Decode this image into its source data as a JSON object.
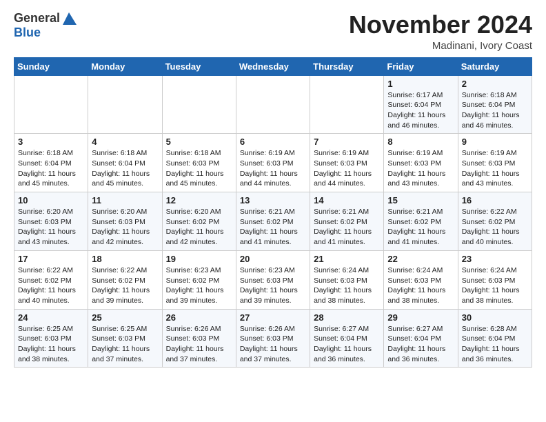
{
  "header": {
    "logo_general": "General",
    "logo_blue": "Blue",
    "month_title": "November 2024",
    "location": "Madinani, Ivory Coast"
  },
  "calendar": {
    "days_of_week": [
      "Sunday",
      "Monday",
      "Tuesday",
      "Wednesday",
      "Thursday",
      "Friday",
      "Saturday"
    ],
    "weeks": [
      [
        {
          "day": "",
          "info": ""
        },
        {
          "day": "",
          "info": ""
        },
        {
          "day": "",
          "info": ""
        },
        {
          "day": "",
          "info": ""
        },
        {
          "day": "",
          "info": ""
        },
        {
          "day": "1",
          "info": "Sunrise: 6:17 AM\nSunset: 6:04 PM\nDaylight: 11 hours and 46 minutes."
        },
        {
          "day": "2",
          "info": "Sunrise: 6:18 AM\nSunset: 6:04 PM\nDaylight: 11 hours and 46 minutes."
        }
      ],
      [
        {
          "day": "3",
          "info": "Sunrise: 6:18 AM\nSunset: 6:04 PM\nDaylight: 11 hours and 45 minutes."
        },
        {
          "day": "4",
          "info": "Sunrise: 6:18 AM\nSunset: 6:04 PM\nDaylight: 11 hours and 45 minutes."
        },
        {
          "day": "5",
          "info": "Sunrise: 6:18 AM\nSunset: 6:03 PM\nDaylight: 11 hours and 45 minutes."
        },
        {
          "day": "6",
          "info": "Sunrise: 6:19 AM\nSunset: 6:03 PM\nDaylight: 11 hours and 44 minutes."
        },
        {
          "day": "7",
          "info": "Sunrise: 6:19 AM\nSunset: 6:03 PM\nDaylight: 11 hours and 44 minutes."
        },
        {
          "day": "8",
          "info": "Sunrise: 6:19 AM\nSunset: 6:03 PM\nDaylight: 11 hours and 43 minutes."
        },
        {
          "day": "9",
          "info": "Sunrise: 6:19 AM\nSunset: 6:03 PM\nDaylight: 11 hours and 43 minutes."
        }
      ],
      [
        {
          "day": "10",
          "info": "Sunrise: 6:20 AM\nSunset: 6:03 PM\nDaylight: 11 hours and 43 minutes."
        },
        {
          "day": "11",
          "info": "Sunrise: 6:20 AM\nSunset: 6:03 PM\nDaylight: 11 hours and 42 minutes."
        },
        {
          "day": "12",
          "info": "Sunrise: 6:20 AM\nSunset: 6:02 PM\nDaylight: 11 hours and 42 minutes."
        },
        {
          "day": "13",
          "info": "Sunrise: 6:21 AM\nSunset: 6:02 PM\nDaylight: 11 hours and 41 minutes."
        },
        {
          "day": "14",
          "info": "Sunrise: 6:21 AM\nSunset: 6:02 PM\nDaylight: 11 hours and 41 minutes."
        },
        {
          "day": "15",
          "info": "Sunrise: 6:21 AM\nSunset: 6:02 PM\nDaylight: 11 hours and 41 minutes."
        },
        {
          "day": "16",
          "info": "Sunrise: 6:22 AM\nSunset: 6:02 PM\nDaylight: 11 hours and 40 minutes."
        }
      ],
      [
        {
          "day": "17",
          "info": "Sunrise: 6:22 AM\nSunset: 6:02 PM\nDaylight: 11 hours and 40 minutes."
        },
        {
          "day": "18",
          "info": "Sunrise: 6:22 AM\nSunset: 6:02 PM\nDaylight: 11 hours and 39 minutes."
        },
        {
          "day": "19",
          "info": "Sunrise: 6:23 AM\nSunset: 6:02 PM\nDaylight: 11 hours and 39 minutes."
        },
        {
          "day": "20",
          "info": "Sunrise: 6:23 AM\nSunset: 6:03 PM\nDaylight: 11 hours and 39 minutes."
        },
        {
          "day": "21",
          "info": "Sunrise: 6:24 AM\nSunset: 6:03 PM\nDaylight: 11 hours and 38 minutes."
        },
        {
          "day": "22",
          "info": "Sunrise: 6:24 AM\nSunset: 6:03 PM\nDaylight: 11 hours and 38 minutes."
        },
        {
          "day": "23",
          "info": "Sunrise: 6:24 AM\nSunset: 6:03 PM\nDaylight: 11 hours and 38 minutes."
        }
      ],
      [
        {
          "day": "24",
          "info": "Sunrise: 6:25 AM\nSunset: 6:03 PM\nDaylight: 11 hours and 38 minutes."
        },
        {
          "day": "25",
          "info": "Sunrise: 6:25 AM\nSunset: 6:03 PM\nDaylight: 11 hours and 37 minutes."
        },
        {
          "day": "26",
          "info": "Sunrise: 6:26 AM\nSunset: 6:03 PM\nDaylight: 11 hours and 37 minutes."
        },
        {
          "day": "27",
          "info": "Sunrise: 6:26 AM\nSunset: 6:03 PM\nDaylight: 11 hours and 37 minutes."
        },
        {
          "day": "28",
          "info": "Sunrise: 6:27 AM\nSunset: 6:04 PM\nDaylight: 11 hours and 36 minutes."
        },
        {
          "day": "29",
          "info": "Sunrise: 6:27 AM\nSunset: 6:04 PM\nDaylight: 11 hours and 36 minutes."
        },
        {
          "day": "30",
          "info": "Sunrise: 6:28 AM\nSunset: 6:04 PM\nDaylight: 11 hours and 36 minutes."
        }
      ]
    ]
  }
}
